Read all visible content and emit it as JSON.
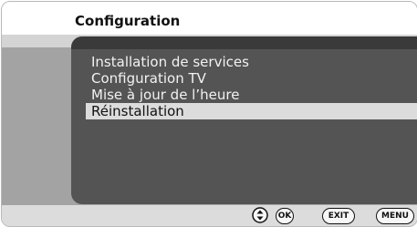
{
  "header": {
    "title": "Configuration"
  },
  "menu": {
    "items": [
      {
        "label": "Installation de services"
      },
      {
        "label": "Configuration TV"
      },
      {
        "label": "Mise à jour de l’heure"
      },
      {
        "label": "Réinstallation",
        "selected": true
      }
    ]
  },
  "footer": {
    "nav_icon": "up-down-navigation-icon",
    "ok_label": "OK",
    "exit_label": "EXIT",
    "menu_label": "MENU"
  }
}
